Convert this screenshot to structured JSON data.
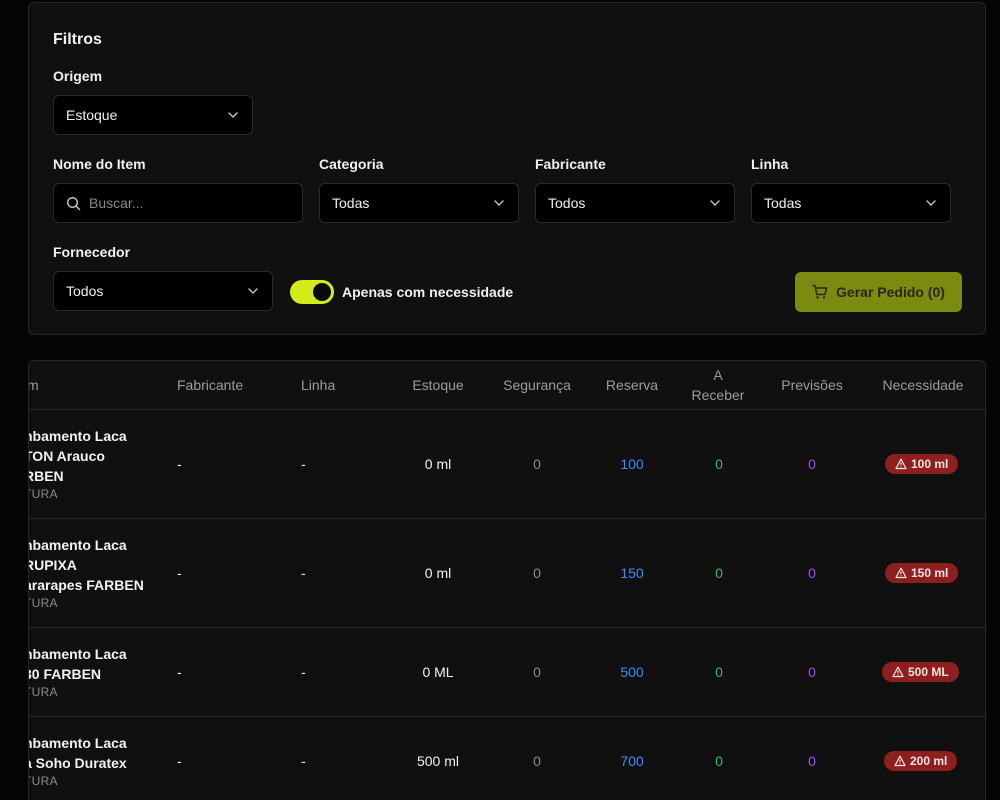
{
  "filters": {
    "title": "Filtros",
    "origin": {
      "label": "Origem",
      "value": "Estoque"
    },
    "item_name": {
      "label": "Nome do Item",
      "placeholder": "Buscar..."
    },
    "category": {
      "label": "Categoria",
      "value": "Todas"
    },
    "manufacturer": {
      "label": "Fabricante",
      "value": "Todos"
    },
    "line": {
      "label": "Linha",
      "value": "Todas"
    },
    "supplier": {
      "label": "Fornecedor",
      "value": "Todos"
    },
    "only_needed": {
      "label": "Apenas com necessidade",
      "enabled": true
    },
    "order_button": "Gerar Pedido (0)"
  },
  "table": {
    "headers": {
      "item": "m",
      "manufacturer": "Fabricante",
      "line": "Linha",
      "stock": "Estoque",
      "safety": "Segurança",
      "reserve": "Reserva",
      "to_receive": "A Receber",
      "forecasts": "Previsões",
      "need": "Necessidade"
    },
    "rows": [
      {
        "name_lines": [
          "nbamento Laca",
          "TON Arauco",
          "RBEN"
        ],
        "category": "TURA",
        "manufacturer": "-",
        "line": "-",
        "stock": "0 ml",
        "safety": "0",
        "reserve": "100",
        "to_receive": "0",
        "forecasts": "0",
        "need": "100 ml"
      },
      {
        "name_lines": [
          "nbamento Laca",
          "RUPIXA",
          "ararapes FARBEN"
        ],
        "category": "TURA",
        "manufacturer": "-",
        "line": "-",
        "stock": "0 ml",
        "safety": "0",
        "reserve": "150",
        "to_receive": "0",
        "forecasts": "0",
        "need": "150 ml"
      },
      {
        "name_lines": [
          "nbamento Laca",
          "30 FARBEN"
        ],
        "category": "TURA",
        "manufacturer": "-",
        "line": "-",
        "stock": "0 ML",
        "safety": "0",
        "reserve": "500",
        "to_receive": "0",
        "forecasts": "0",
        "need": "500 ML"
      },
      {
        "name_lines": [
          "nbamento Laca",
          "a Soho Duratex"
        ],
        "category": "TURA",
        "manufacturer": "-",
        "line": "-",
        "stock": "500 ml",
        "safety": "0",
        "reserve": "700",
        "to_receive": "0",
        "forecasts": "0",
        "need": "200 ml"
      }
    ]
  },
  "colors": {
    "accent": "#d4ec1a",
    "reserve": "#3d8bff",
    "to_receive": "#2fbf5b",
    "forecasts": "#a24cff",
    "need_badge": "#8e1f1f"
  },
  "icons": [
    "chevron-down-icon",
    "search-icon",
    "cart-icon",
    "warning-icon"
  ]
}
